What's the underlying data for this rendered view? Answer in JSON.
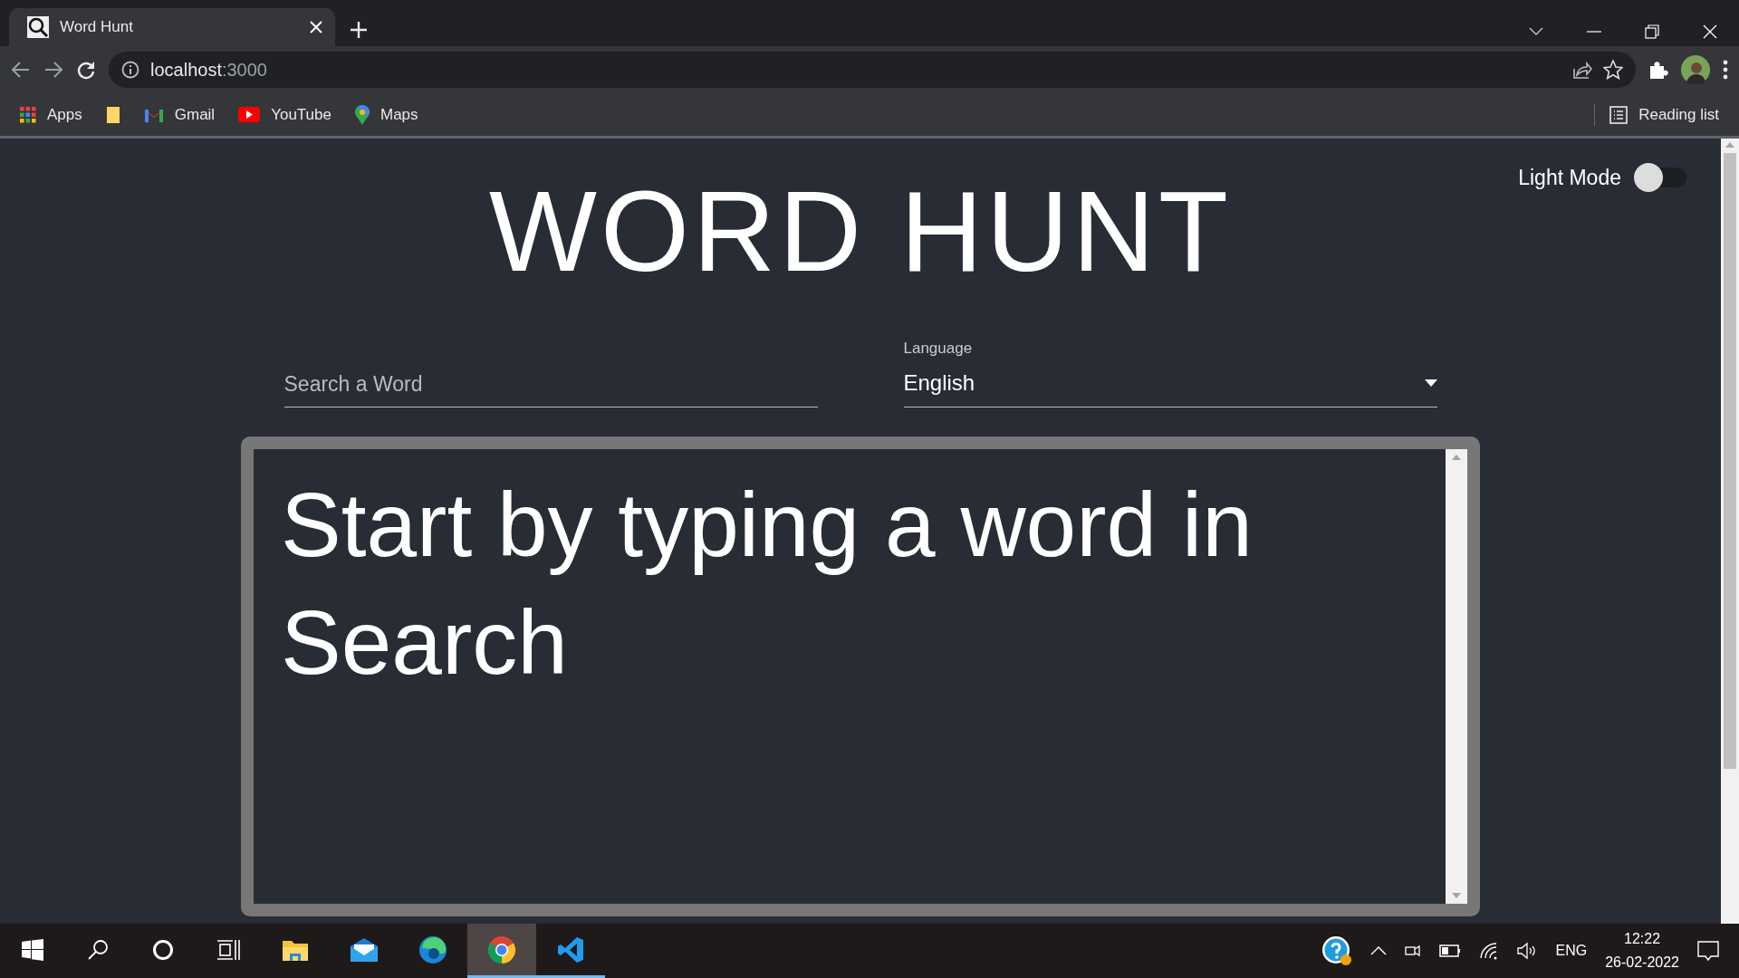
{
  "browser": {
    "tab": {
      "title": "Word Hunt"
    },
    "address": {
      "host": "localhost",
      "port": ":3000"
    },
    "bookmarks": [
      {
        "kind": "apps",
        "label": "Apps"
      },
      {
        "kind": "folder"
      },
      {
        "kind": "gmail",
        "label": "Gmail"
      },
      {
        "kind": "youtube",
        "label": "YouTube"
      },
      {
        "kind": "maps",
        "label": "Maps"
      }
    ],
    "reading_list": "Reading list"
  },
  "page": {
    "theme_toggle": {
      "label": "Light Mode",
      "on": false
    },
    "title": "WORD HUNT",
    "search": {
      "placeholder": "Search a Word"
    },
    "language": {
      "label": "Language",
      "value": "English"
    },
    "message": "Start by typing a word in Search"
  },
  "taskbar": {
    "apps": [
      {
        "kind": "explorer",
        "selected": false,
        "running": false
      },
      {
        "kind": "mail",
        "selected": false,
        "running": false
      },
      {
        "kind": "edge",
        "selected": false,
        "running": false
      },
      {
        "kind": "chrome",
        "selected": true,
        "running": true
      },
      {
        "kind": "vscode",
        "selected": false,
        "running": true
      }
    ],
    "language": "ENG",
    "time": "12:22",
    "date": "26-02-2022"
  }
}
